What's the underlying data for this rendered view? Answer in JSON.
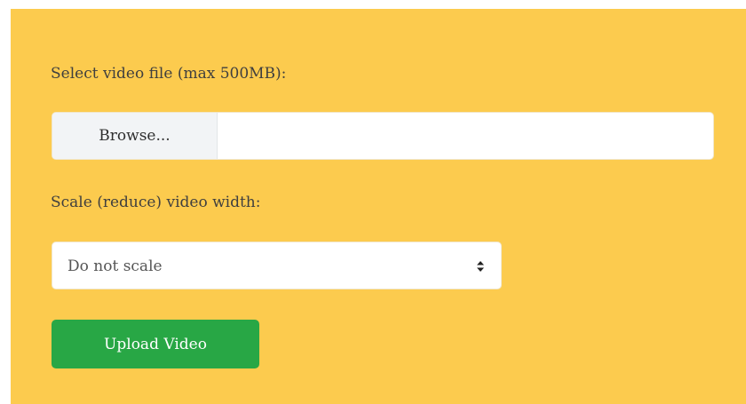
{
  "form": {
    "file_label": "Select video file (max 500MB):",
    "browse_label": "Browse...",
    "file_name": "",
    "scale_label": "Scale (reduce) video width:",
    "scale_selected": "Do not scale",
    "upload_label": "Upload Video"
  },
  "icons": {
    "select_arrows": "updown-arrows-icon"
  },
  "colors": {
    "panel_background": "#fccb4e",
    "upload_button": "#28a745"
  }
}
